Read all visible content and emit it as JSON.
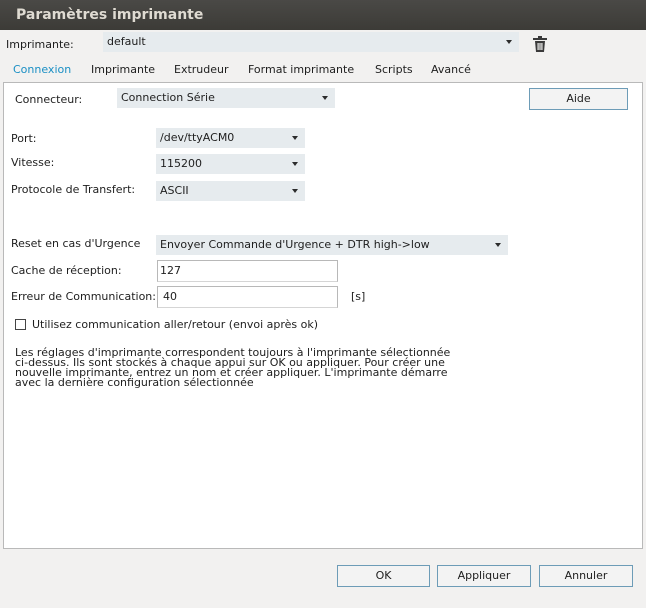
{
  "window": {
    "title": "Paramètres imprimante"
  },
  "printer": {
    "label": "Imprimante:",
    "selected": "default"
  },
  "tabs": [
    {
      "label": "Connexion"
    },
    {
      "label": "Imprimante"
    },
    {
      "label": "Extrudeur"
    },
    {
      "label": "Format imprimante"
    },
    {
      "label": "Scripts"
    },
    {
      "label": "Avancé"
    }
  ],
  "connexion": {
    "connector_label": "Connecteur:",
    "connector_value": "Connection Série",
    "help_button": "Aide",
    "port_label": "Port:",
    "port_value": "/dev/ttyACM0",
    "speed_label": "Vitesse:",
    "speed_value": "115200",
    "protocol_label": "Protocole de Transfert:",
    "protocol_value": "ASCII",
    "reset_label": "Reset en cas d'Urgence",
    "reset_value": "Envoyer Commande d'Urgence + DTR high->low",
    "cache_label": "Cache de réception:",
    "cache_value": "127",
    "error_label": "Erreur de Communication:",
    "error_value": "40",
    "error_unit": "[s]",
    "pingpong_label": "Utilisez communication aller/retour (envoi après ok)",
    "pingpong_checked": false,
    "info_lines": [
      "Les réglages d'imprimante correspondent toujours à l'imprimante sélectionnée",
      "ci-dessus. Ils sont stockés à chaque appui sur OK ou appliquer. Pour créer une",
      "nouvelle imprimante, entrez un nom et créer appliquer. L'imprimante démarre",
      "avec la dernière configuration sélectionnée"
    ]
  },
  "footer": {
    "ok": "OK",
    "apply": "Appliquer",
    "cancel": "Annuler"
  },
  "colors": {
    "accent": "#1a8fc4",
    "titlebar": "#3c3b37",
    "combo_bg": "#e6ebee"
  }
}
